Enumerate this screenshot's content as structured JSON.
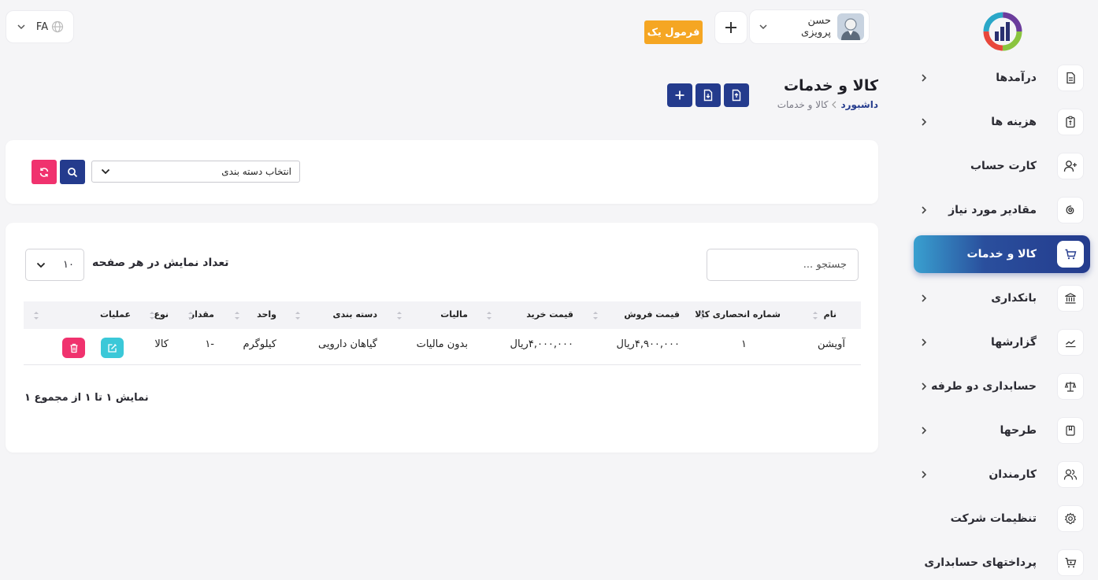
{
  "app": {
    "language": "FA",
    "formula_button": "فرمول یک",
    "user_name": "حسن پرویزی"
  },
  "sidebar": {
    "items": [
      {
        "label": "درآمدها",
        "icon": "document-icon",
        "has_arrow": true
      },
      {
        "label": "هزینه ها",
        "icon": "clipboard-icon",
        "has_arrow": true
      },
      {
        "label": "کارت حساب",
        "icon": "user-plus-icon",
        "has_arrow": false
      },
      {
        "label": "مقادیر مورد نیاز",
        "icon": "spiral-icon",
        "has_arrow": true
      },
      {
        "label": "کالا و خدمات",
        "icon": "cart-icon",
        "has_arrow": false,
        "active": true
      },
      {
        "label": "بانکداری",
        "icon": "bank-icon",
        "has_arrow": true
      },
      {
        "label": "گزارشها",
        "icon": "chart-line-icon",
        "has_arrow": true
      },
      {
        "label": "حسابداری دو طرفه",
        "icon": "scale-icon",
        "has_arrow": true
      },
      {
        "label": "طرحها",
        "icon": "bookmark-icon",
        "has_arrow": true
      },
      {
        "label": "کارمندان",
        "icon": "users-icon",
        "has_arrow": true
      },
      {
        "label": "تنظیمات شرکت",
        "icon": "gear-icon",
        "has_arrow": false
      },
      {
        "label": "پرداختهای حسابداری",
        "icon": "shopping-cart-icon",
        "has_arrow": false
      }
    ]
  },
  "header": {
    "title": "کالا و خدمات",
    "breadcrumb_home": "داشبورد",
    "breadcrumb_current": "کالا و خدمات"
  },
  "filter": {
    "category_placeholder": "انتخاب دسته بندی"
  },
  "table": {
    "search_placeholder": "جستجو ...",
    "page_size_label": "تعداد نمایش در هر صفحه",
    "page_size": "۱۰",
    "columns": {
      "name": "نام",
      "code": "شماره انحصاری کالا",
      "sale_price": "قیمت فروش",
      "purchase_price": "قیمت خرید",
      "tax": "مالیات",
      "category": "دسته بندی",
      "unit": "واحد",
      "quantity": "مقدار",
      "type": "نوع",
      "actions": "عملیات"
    },
    "rows": [
      {
        "name": "آویشن",
        "code": "۱",
        "sale_price": "۴,۹۰۰,۰۰۰ریال",
        "purchase_price": "۴,۰۰۰,۰۰۰ریال",
        "tax": "بدون مالیات",
        "category": "گیاهان دارویی",
        "unit": "کیلوگرم",
        "quantity": "-۱",
        "type": "کالا"
      }
    ],
    "summary": "نمایش ۱ تا ۱ از مجموع ۱"
  },
  "colors": {
    "primary": "#243b8d",
    "accent": "#f5a623",
    "danger": "#f0326e",
    "info": "#3bc8d8",
    "background": "#f5f5f7"
  }
}
